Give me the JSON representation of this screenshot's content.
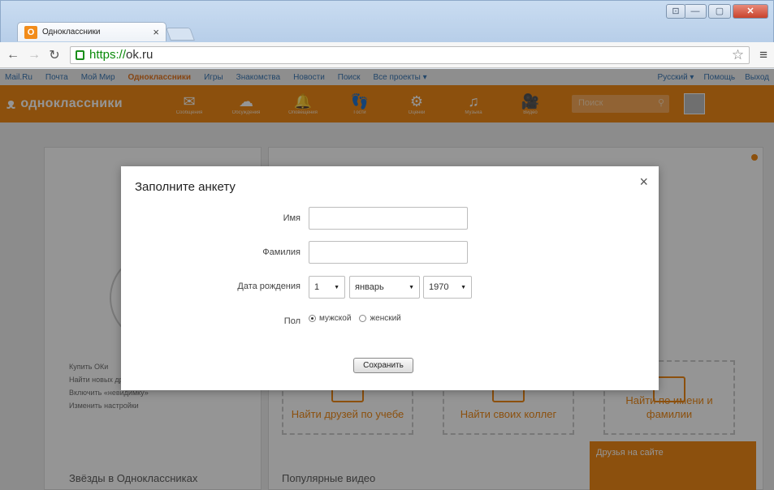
{
  "browser": {
    "tab_title": "Одноклассники",
    "tab_close": "×",
    "favicon_letter": "О",
    "url_scheme": "https://",
    "url_host": "ok.ru",
    "window_buttons": {
      "minimize": "—",
      "maximize": "▢",
      "close": "✕",
      "tray": "⊡"
    }
  },
  "portal_bar": {
    "links": [
      "Mail.Ru",
      "Почта",
      "Мой Мир",
      "Одноклассники",
      "Игры",
      "Знакомства",
      "Новости",
      "Поиск",
      "Все проекты ▾"
    ],
    "active_index": 3,
    "right_links": [
      "Русский ▾",
      "Помощь",
      "Выход"
    ]
  },
  "ok_header": {
    "logo_text": "одноклассники",
    "nav": [
      {
        "icon": "envelope-icon",
        "glyph": "✉",
        "label": "Сообщения"
      },
      {
        "icon": "discussions-icon",
        "glyph": "☁",
        "label": "Обсуждения"
      },
      {
        "icon": "bell-icon",
        "glyph": "🔔",
        "label": "Оповещения"
      },
      {
        "icon": "guests-icon",
        "glyph": "👣",
        "label": "Гости"
      },
      {
        "icon": "ratings-icon",
        "glyph": "⚙",
        "label": "Оценки"
      },
      {
        "icon": "music-icon",
        "glyph": "♫",
        "label": "Музыка"
      },
      {
        "icon": "video-icon",
        "glyph": "🎥",
        "label": "Видео"
      }
    ],
    "search_placeholder": "Поиск",
    "accent": "#ee8208"
  },
  "left_card": {
    "links": [
      "Купить ОКи",
      "Найти новых друзей",
      "Включить «невидимку»",
      "Изменить настройки"
    ],
    "section_title": "Звёзды в Одноклассниках"
  },
  "main_card": {
    "tiles": [
      "Найти друзей по учебе",
      "Найти своих коллег",
      "Найти по имени и фамилии"
    ],
    "section_title": "Популярные видео",
    "friends_online": "Друзья на сайте"
  },
  "modal": {
    "title": "Заполните анкету",
    "close": "×",
    "first_name_label": "Имя",
    "first_name_value": "",
    "last_name_label": "Фамилия",
    "last_name_value": "",
    "birth_label": "Дата рождения",
    "birth_day": "1",
    "birth_month": "январь",
    "birth_year": "1970",
    "gender_label": "Пол",
    "gender_male": "мужской",
    "gender_female": "женский",
    "gender_selected": "male",
    "save_button": "Сохранить"
  }
}
